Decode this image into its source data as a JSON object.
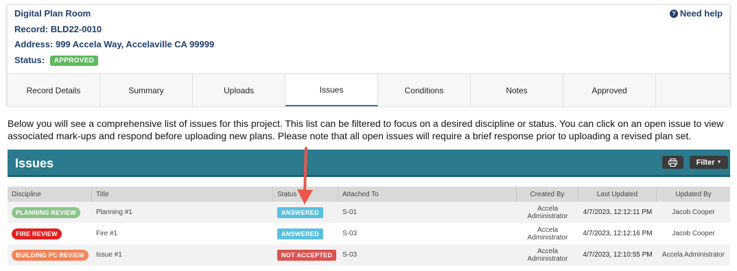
{
  "record": {
    "app_title": "Digital Plan Room",
    "record_label": "Record: BLD22-0010",
    "address_label": "Address: 999 Accela Way, Accelaville CA 99999",
    "status_label": "Status:",
    "status_value": "APPROVED",
    "status_color": "#5cb85c"
  },
  "help": {
    "label": "Need help",
    "icon": "question-circle-icon"
  },
  "tabs": [
    {
      "label": "Record Details"
    },
    {
      "label": "Summary"
    },
    {
      "label": "Uploads"
    },
    {
      "label": "Issues",
      "active": true
    },
    {
      "label": "Conditions"
    },
    {
      "label": "Notes"
    },
    {
      "label": "Approved"
    }
  ],
  "intro_text": "Below you will see a comprehensive list of issues for this project. This list can be filtered to focus on a desired discipline or status. You can click on an open issue to view associated mark-ups and respond before uploading new plans. Please note that all open issues will require a brief response prior to uploading a revised plan set.",
  "issues_panel": {
    "title": "Issues",
    "print_icon": "printer-icon",
    "filter_label": "Filter",
    "bar_color": "#2b7a8e"
  },
  "table": {
    "headers": [
      "Discipline",
      "Title",
      "Status",
      "Attached To",
      "Created By",
      "Last Updated",
      "Updated By"
    ],
    "rows": [
      {
        "discipline": "PLANNING REVIEW",
        "discipline_color": "#8bc48a",
        "title": "Planning #1",
        "status": "ANSWERED",
        "status_color": "#5bc0de",
        "attached_to": "S-01",
        "created_by": "Accela Administrator",
        "last_updated": "4/7/2023, 12:12:11 PM",
        "updated_by": "Jacob Cooper"
      },
      {
        "discipline": "FIRE REVIEW",
        "discipline_color": "#e02020",
        "title": "Fire #1",
        "status": "ANSWERED",
        "status_color": "#5bc0de",
        "attached_to": "S-03",
        "created_by": "Accela Administrator",
        "last_updated": "4/7/2023, 12:12:16 PM",
        "updated_by": "Jacob Cooper"
      },
      {
        "discipline": "BUILDING PC REVIEW",
        "discipline_color": "#f0855a",
        "title": "Issue #1",
        "status": "NOT ACCEPTED",
        "status_color": "#d9534f",
        "attached_to": "S-03",
        "created_by": "Accela Administrator",
        "last_updated": "4/7/2023, 12:10:55 PM",
        "updated_by": "Accela Administrator"
      }
    ]
  },
  "annotation": {
    "arrow_color": "#e8574a"
  }
}
